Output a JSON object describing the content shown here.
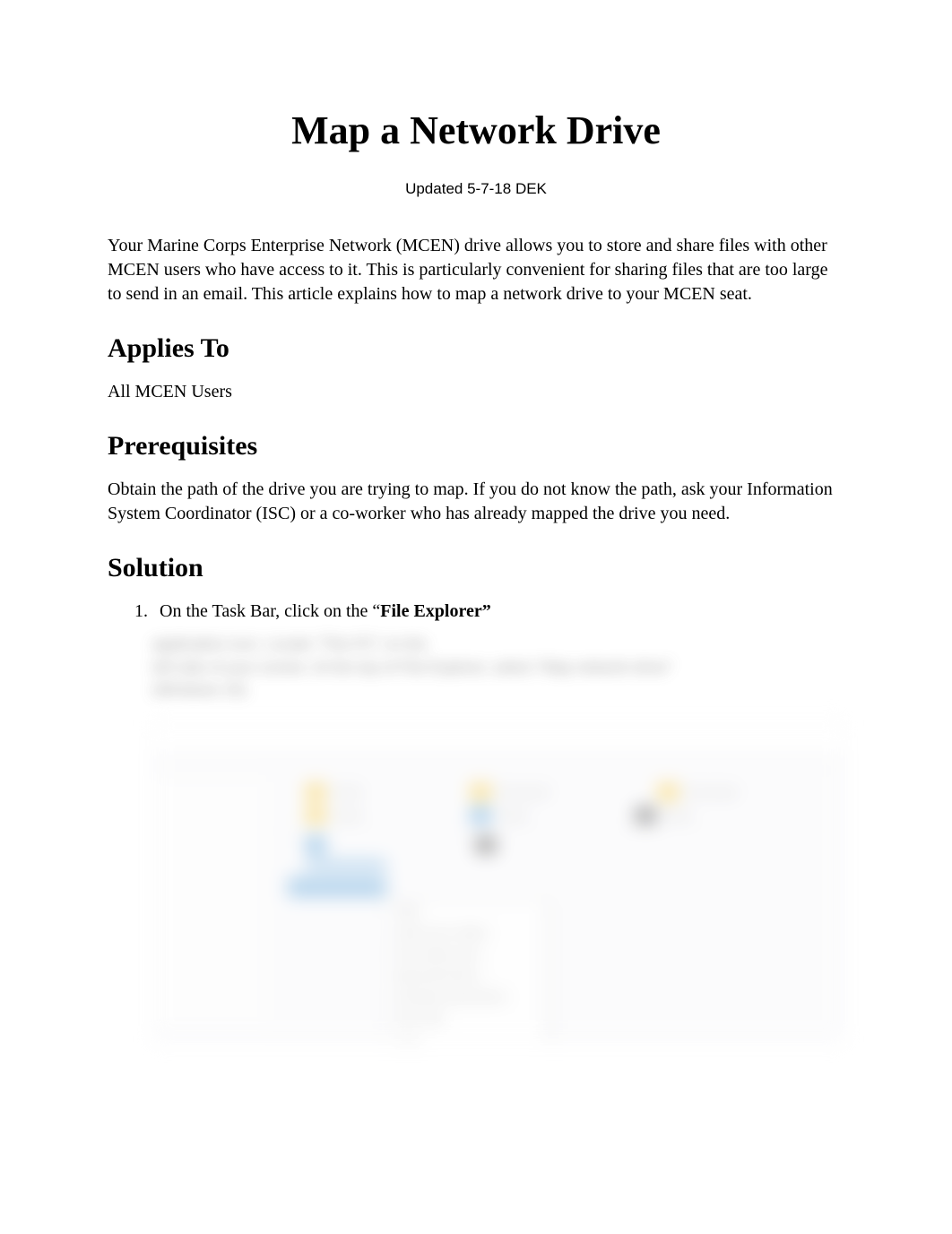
{
  "title": "Map a Network Drive",
  "updated": "Updated 5-7-18 DEK",
  "intro": "Your Marine Corps Enterprise Network (MCEN) drive allows you to store and share files with other MCEN users who have access to it. This is particularly convenient for sharing files that are too large to send in an email. This article explains how to map a network drive to your MCEN seat.",
  "sections": {
    "applies_to": {
      "heading": "Applies To",
      "text": "All MCEN Users"
    },
    "prerequisites": {
      "heading": "Prerequisites",
      "text": "Obtain the path of the drive you are trying to map. If you do not know the path, ask your Information System Coordinator (ISC) or a co-worker who has already mapped the drive you need."
    },
    "solution": {
      "heading": "Solution",
      "step1_prefix": "On the Task Bar, click on the “",
      "step1_bold": "File Explorer”",
      "step1_blur_line1": "application icon. Locate “This PC” on the",
      "step1_blur_line2": "left side of your screen. At the top of File Explorer, select “Map network drive”",
      "step1_blur_line3": "(Windows 10)."
    }
  }
}
